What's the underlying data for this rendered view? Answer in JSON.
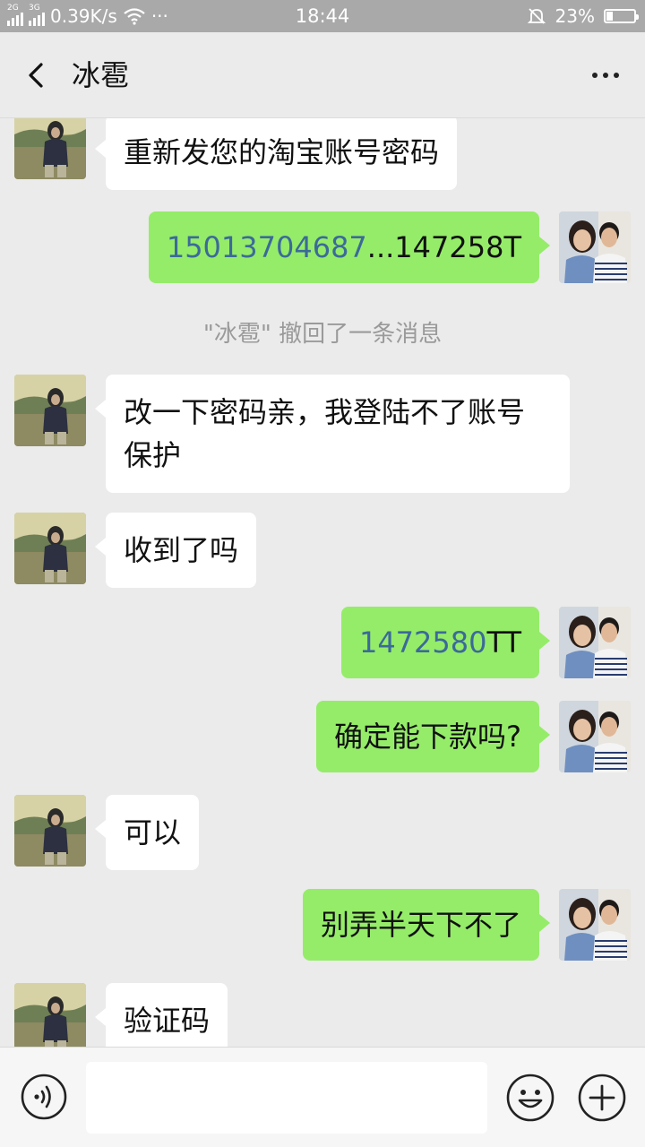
{
  "status_bar": {
    "network_1": "2G",
    "network_2": "3G",
    "speed": "0.39K/s",
    "more_dots": "···",
    "time": "18:44",
    "battery": "23%",
    "battery_level": 0.23
  },
  "header": {
    "title": "冰雹",
    "back_icon": "chevron-left-icon",
    "more_icon": "more-dots-icon"
  },
  "messages": [
    {
      "side": "in",
      "text": "重新发您的淘宝账号密码"
    },
    {
      "side": "out",
      "number": "15013704687",
      "suffix": "...147258T"
    },
    {
      "type": "system",
      "text": "\"冰雹\" 撤回了一条消息"
    },
    {
      "side": "in",
      "text": "改一下密码亲，我登陆不了账号保护"
    },
    {
      "side": "in",
      "text": "收到了吗"
    },
    {
      "side": "out",
      "number": "1472580",
      "suffix": "TT"
    },
    {
      "side": "out",
      "text": "确定能下款吗?"
    },
    {
      "side": "in",
      "text": "可以"
    },
    {
      "side": "out",
      "text": "别弄半天下不了"
    },
    {
      "side": "in",
      "text": "验证码"
    }
  ],
  "input_bar": {
    "voice_icon": "voice-icon",
    "message_value": "",
    "emoji_icon": "emoji-icon",
    "plus_icon": "plus-icon"
  },
  "colors": {
    "bubble_out": "#95ec69",
    "bubble_in": "#ffffff",
    "background": "#ebebeb",
    "link_number": "#3b6a99"
  }
}
